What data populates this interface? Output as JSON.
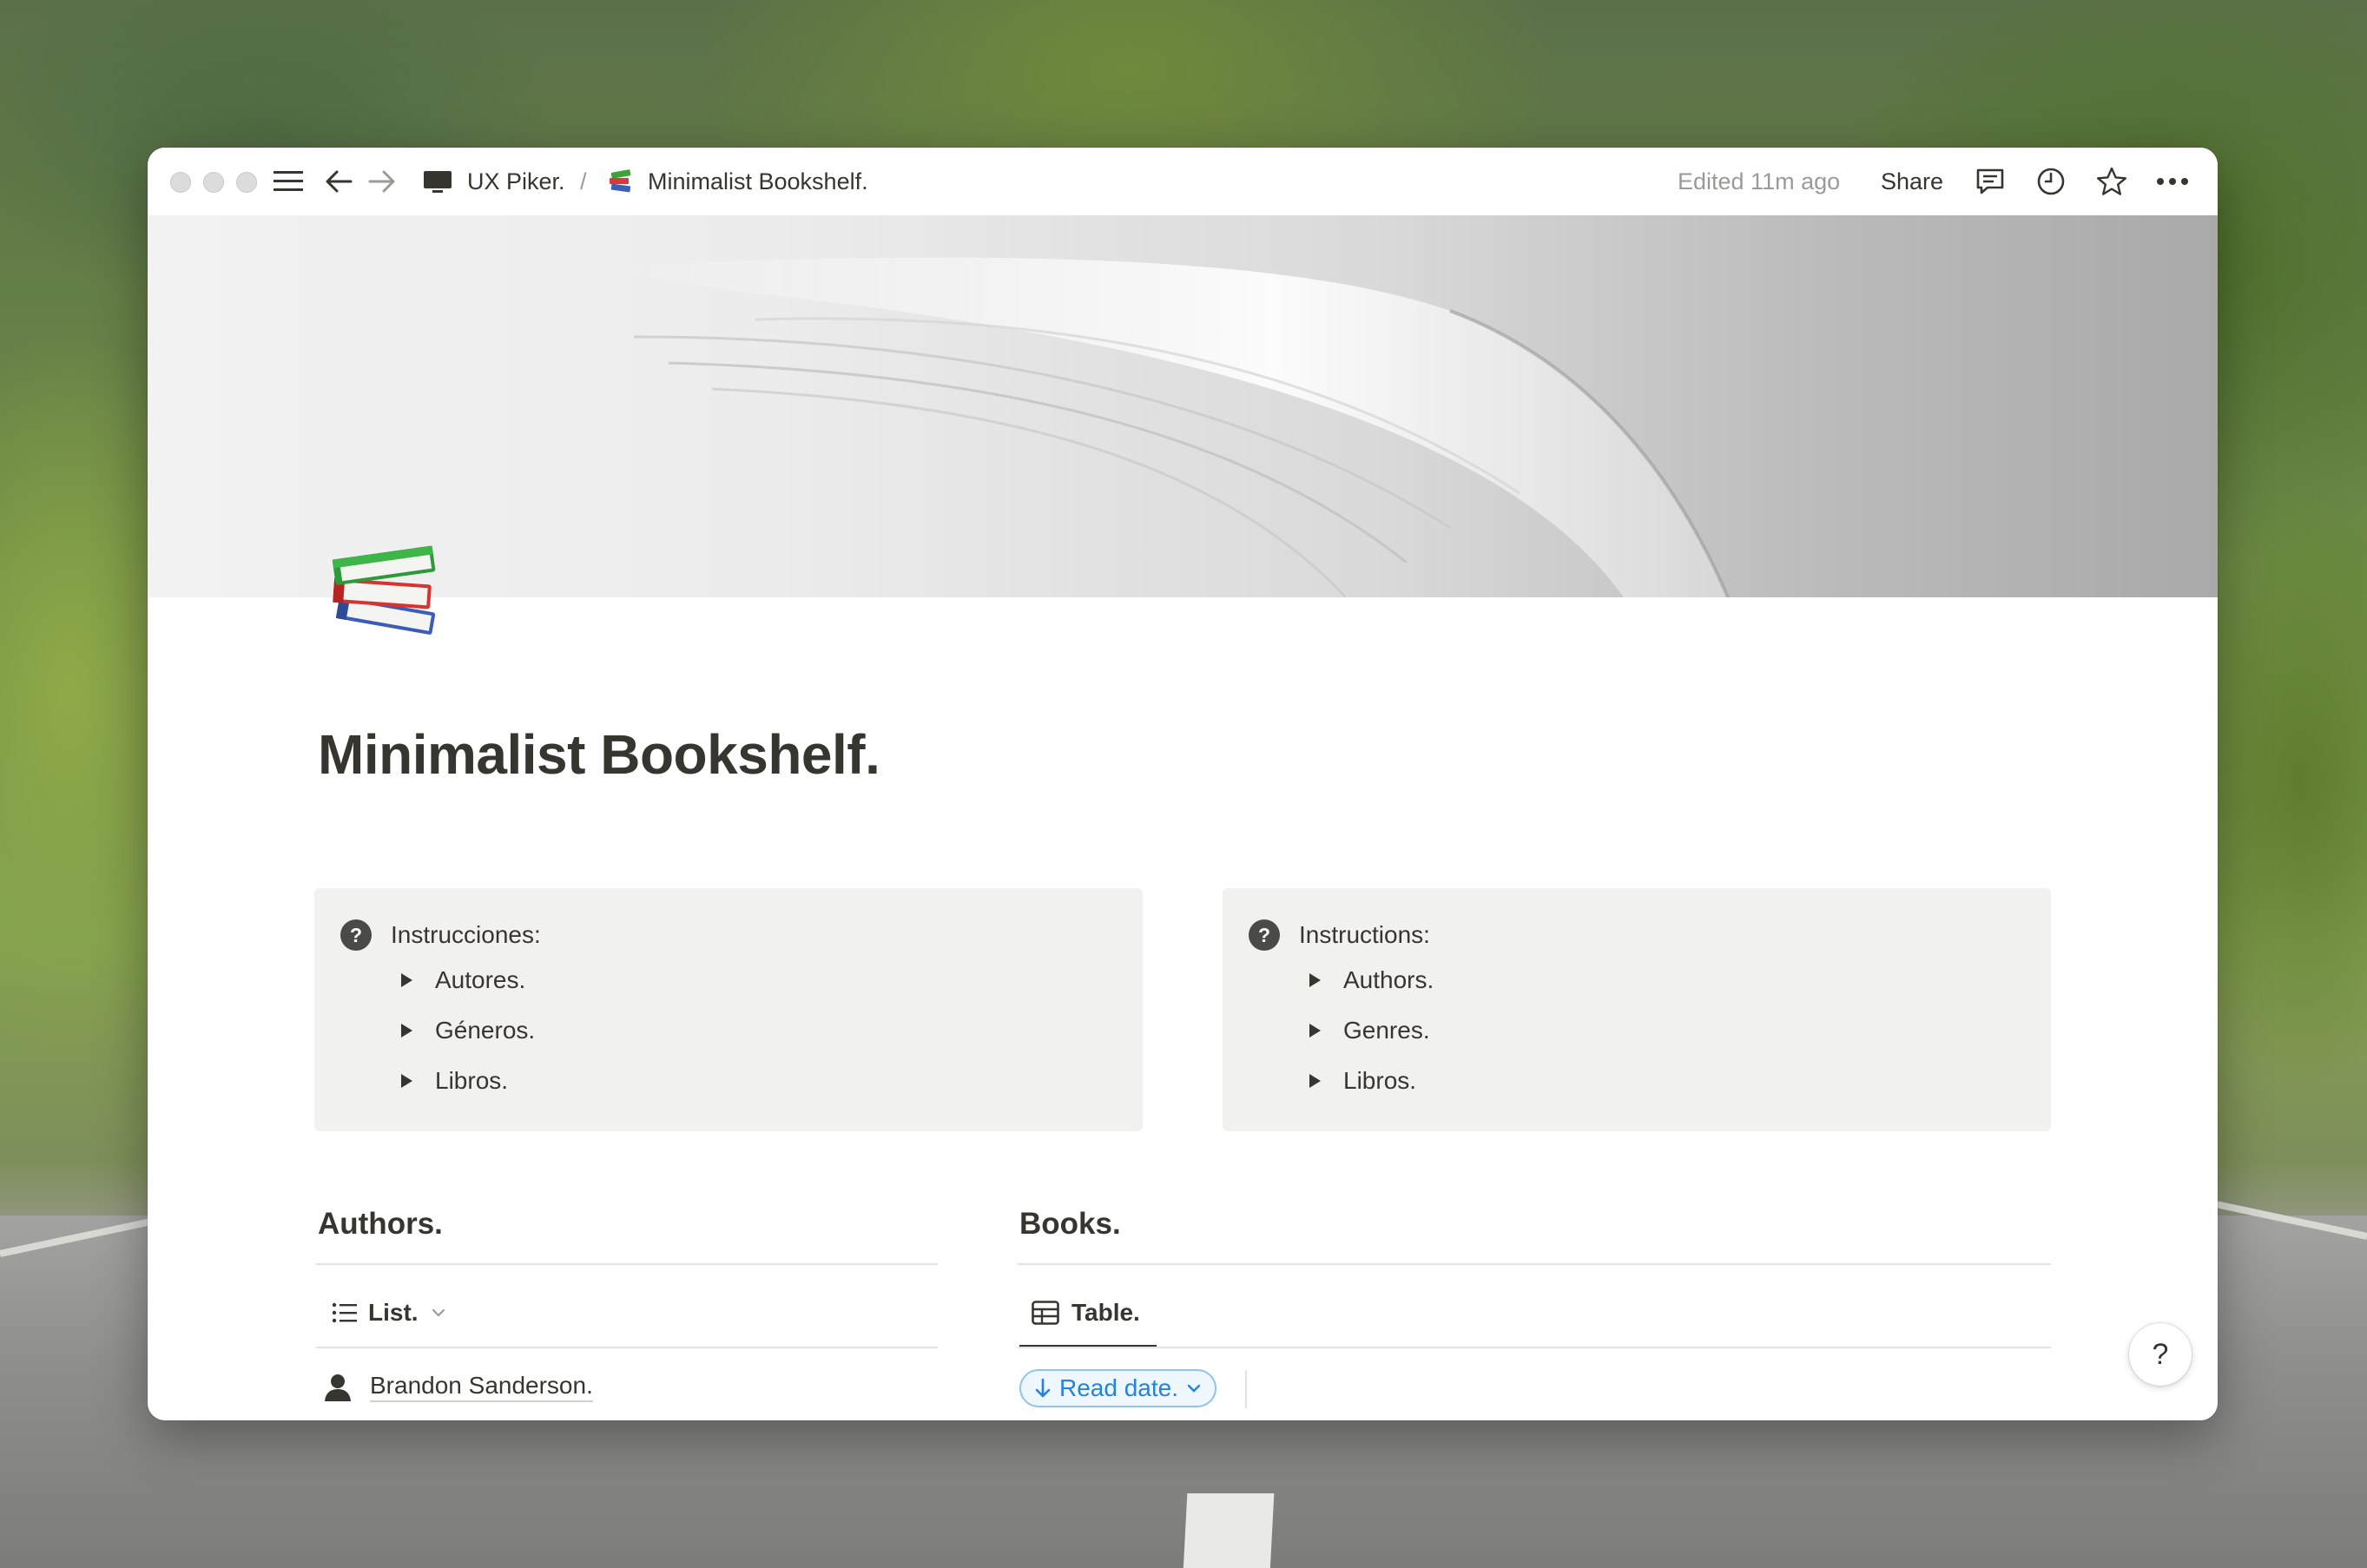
{
  "breadcrumb": {
    "workspace": "UX Piker.",
    "separator": "/",
    "page": "Minimalist Bookshelf."
  },
  "header": {
    "edited": "Edited 11m ago",
    "share_label": "Share"
  },
  "page": {
    "title": "Minimalist Bookshelf.",
    "icon": "books-emoji"
  },
  "callouts": [
    {
      "icon": "question-circle-icon",
      "heading": "Instrucciones:",
      "items": [
        "Autores.",
        "Géneros.",
        "Libros."
      ]
    },
    {
      "icon": "question-circle-icon",
      "heading": "Instructions:",
      "items": [
        "Authors.",
        "Genres.",
        "Libros."
      ]
    }
  ],
  "authors": {
    "title": "Authors.",
    "view_label": "List.",
    "items": [
      "Brandon Sanderson."
    ]
  },
  "books": {
    "title": "Books.",
    "view_label": "Table.",
    "sort_label": "Read date."
  },
  "help": {
    "label": "?"
  },
  "colors": {
    "text": "#37352f",
    "muted": "#9b9a97",
    "callout_bg": "#f1f1ef",
    "accent_blue": "#2383e2"
  }
}
